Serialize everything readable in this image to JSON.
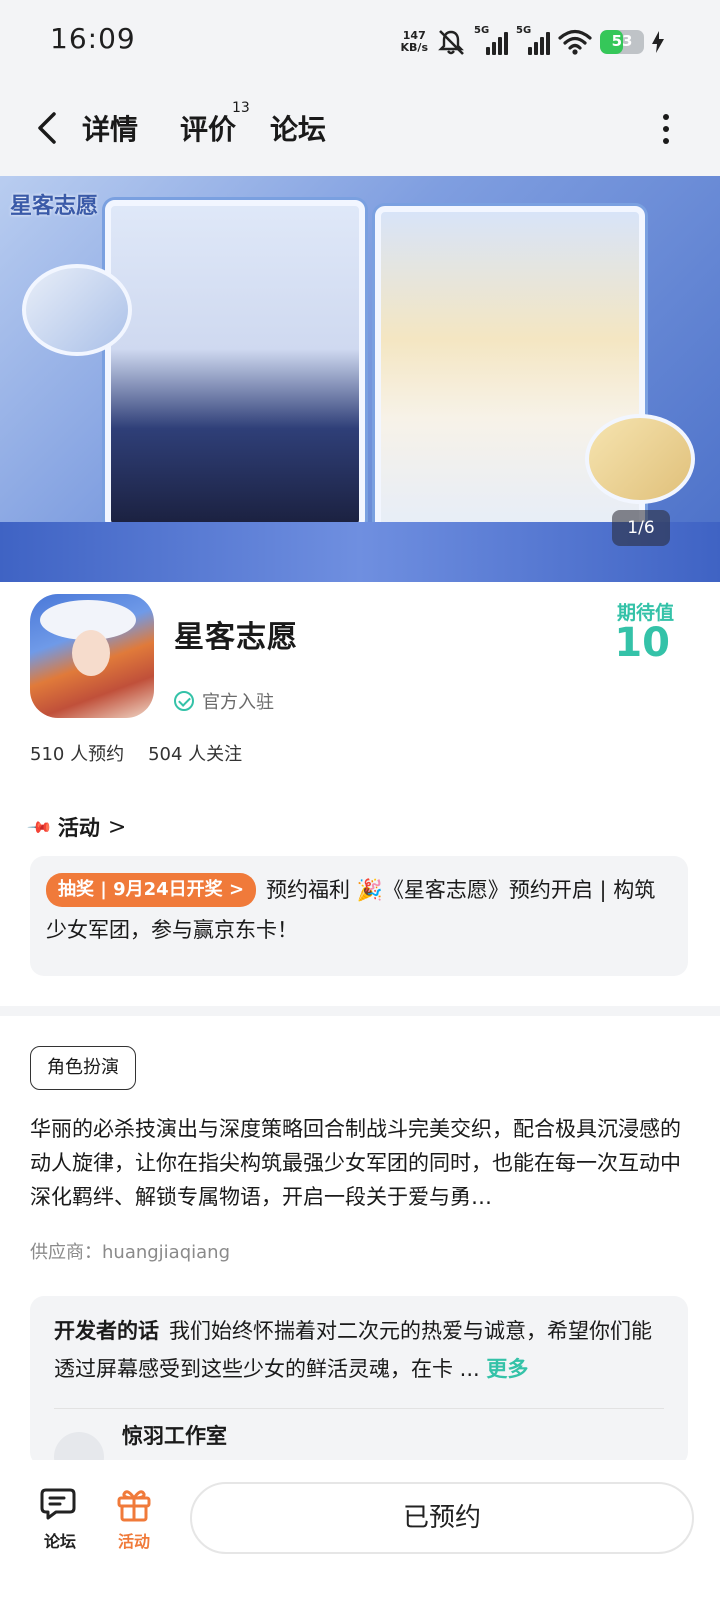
{
  "status_bar": {
    "time": "16:09",
    "net_speed_value": "147",
    "net_speed_unit": "KB/s",
    "sim1": "5G",
    "sim2": "5G",
    "battery": "53"
  },
  "nav": {
    "tabs": [
      {
        "label": "详情",
        "active": true
      },
      {
        "label": "评价",
        "count": "13"
      },
      {
        "label": "论坛"
      }
    ]
  },
  "banner": {
    "brand_text": "星客志愿",
    "counter_current": "1",
    "counter_total": "6"
  },
  "app": {
    "name": "星客志愿",
    "official_label": "官方入驻",
    "expect_label": "期待值",
    "expect_value": "10",
    "reservations": "510 人预约",
    "followers": "504 人关注"
  },
  "activity": {
    "title": "活动",
    "badge": "抽奖 | 9月24日开奖 >",
    "text": "预约福利 🎉《星客志愿》预约开启 | 构筑少女军团，参与赢京东卡！"
  },
  "genre": "角色扮演",
  "description": "华丽的必杀技演出与深度策略回合制战斗完美交织，配合极具沉浸感的动人旋律，让你在指尖构筑最强少女军团的同时，也能在每一次互动中深化羁绊、解锁专属物语，开启一段关于爱与勇…",
  "supplier": "供应商：huangjiaqiang",
  "developer": {
    "title": "开发者的话",
    "text": "我们始终怀揣着对二次元的热爱与诚意，希望你们能透过屏幕感受到这些少女的鲜活灵魂，在卡 ...",
    "more": "更多",
    "studio": "惊羽工作室"
  },
  "bottom_bar": {
    "forum_label": "论坛",
    "activity_label": "活动",
    "reserved_button": "已预约"
  },
  "colors": {
    "accent": "#34c2a8",
    "orange": "#f07a3a",
    "surface": "#f3f4f6"
  }
}
